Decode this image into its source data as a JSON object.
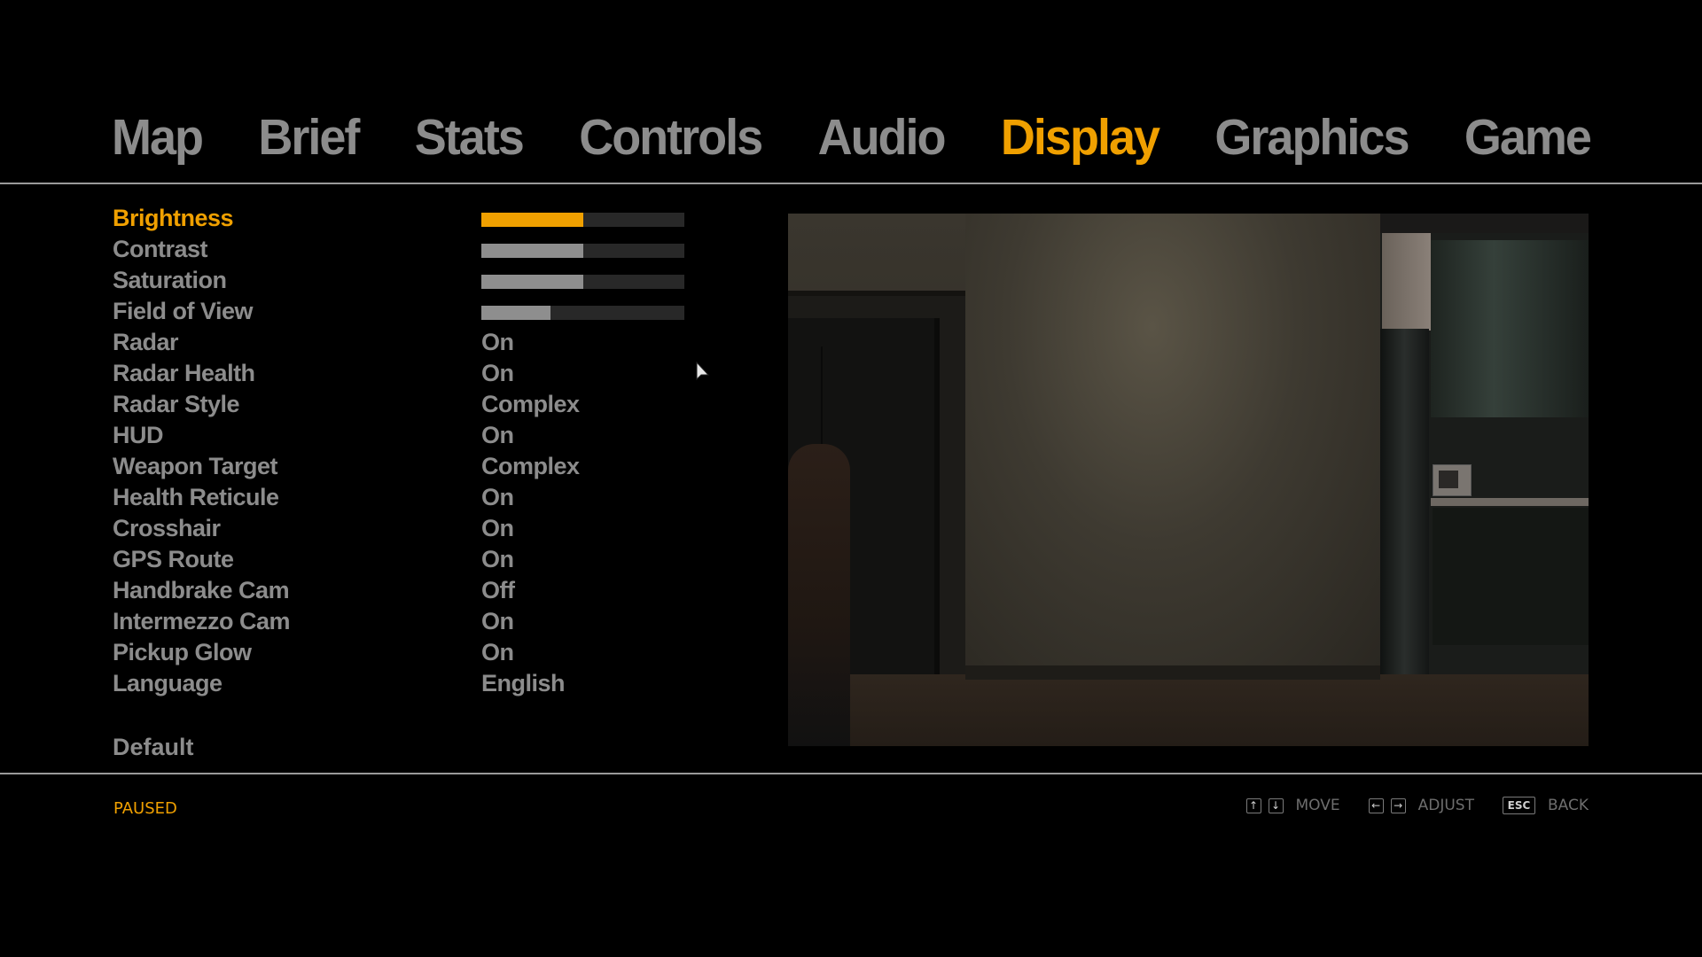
{
  "tabs": [
    {
      "label": "Map",
      "active": false
    },
    {
      "label": "Brief",
      "active": false
    },
    {
      "label": "Stats",
      "active": false
    },
    {
      "label": "Controls",
      "active": false
    },
    {
      "label": "Audio",
      "active": false
    },
    {
      "label": "Display",
      "active": true
    },
    {
      "label": "Graphics",
      "active": false
    },
    {
      "label": "Game",
      "active": false
    }
  ],
  "settings": [
    {
      "label": "Brightness",
      "type": "slider",
      "level": 0.5,
      "selected": true
    },
    {
      "label": "Contrast",
      "type": "slider",
      "level": 0.5
    },
    {
      "label": "Saturation",
      "type": "slider",
      "level": 0.5
    },
    {
      "label": "Field of View",
      "type": "slider",
      "level": 0.34
    },
    {
      "label": "Radar",
      "type": "option",
      "value": "On"
    },
    {
      "label": "Radar Health",
      "type": "option",
      "value": "On"
    },
    {
      "label": "Radar Style",
      "type": "option",
      "value": "Complex"
    },
    {
      "label": "HUD",
      "type": "option",
      "value": "On"
    },
    {
      "label": "Weapon Target",
      "type": "option",
      "value": "Complex"
    },
    {
      "label": "Health Reticule",
      "type": "option",
      "value": "On"
    },
    {
      "label": "Crosshair",
      "type": "option",
      "value": "On"
    },
    {
      "label": "GPS Route",
      "type": "option",
      "value": "On"
    },
    {
      "label": "Handbrake Cam",
      "type": "option",
      "value": "Off"
    },
    {
      "label": "Intermezzo Cam",
      "type": "option",
      "value": "On"
    },
    {
      "label": "Pickup Glow",
      "type": "option",
      "value": "On"
    },
    {
      "label": "Language",
      "type": "option",
      "value": "English"
    }
  ],
  "default_label": "Default",
  "status": "PAUSED",
  "hints": {
    "move": {
      "keys": [
        "↑",
        "↓"
      ],
      "key_icons": [
        "arrow-up-key-icon",
        "arrow-down-key-icon"
      ],
      "label": "MOVE"
    },
    "adjust": {
      "keys": [
        "←",
        "→"
      ],
      "key_icons": [
        "arrow-left-key-icon",
        "arrow-right-key-icon"
      ],
      "label": "ADJUST"
    },
    "back": {
      "key": "ESC",
      "label": "BACK"
    }
  },
  "colors": {
    "accent": "#f0a000",
    "text": "#8c8c8c",
    "bar_track": "#282828",
    "bar_fill": "#8e8e8e",
    "divider": "#9a9a9a",
    "background": "#000000"
  }
}
